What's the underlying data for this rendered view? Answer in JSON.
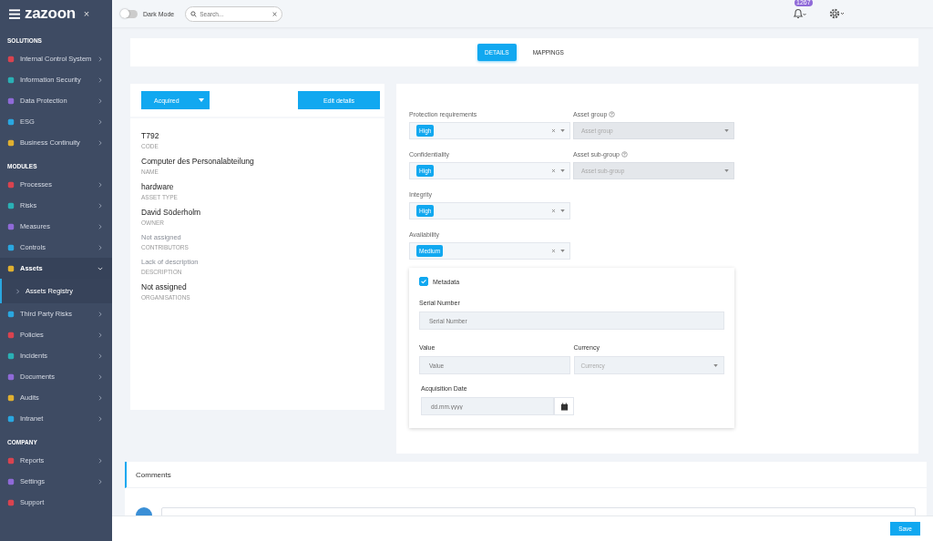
{
  "sidebar": {
    "logo": "zazoon",
    "close": "×",
    "sections": [
      {
        "heading": "SOLUTIONS",
        "items": [
          {
            "label": "Internal Control System",
            "color": "#d9434f",
            "expanded": false
          },
          {
            "label": "Information Security",
            "color": "#2ab0b5",
            "expanded": false
          },
          {
            "label": "Data Protection",
            "color": "#8f6ad8",
            "expanded": false
          },
          {
            "label": "ESG",
            "color": "#2aa7e0",
            "expanded": false
          },
          {
            "label": "Business Continuity",
            "color": "#e0b030",
            "expanded": false
          }
        ]
      },
      {
        "heading": "MODULES",
        "items": [
          {
            "label": "Processes",
            "color": "#d9434f",
            "expanded": false
          },
          {
            "label": "Risks",
            "color": "#2ab0b5",
            "expanded": false
          },
          {
            "label": "Measures",
            "color": "#8f6ad8",
            "expanded": false
          },
          {
            "label": "Controls",
            "color": "#2aa7e0",
            "expanded": false
          },
          {
            "label": "Assets",
            "color": "#e0b030",
            "expanded": true,
            "children": [
              {
                "label": "Assets Registry",
                "selected": true
              }
            ]
          },
          {
            "label": "Third Party Risks",
            "color": "#2aa7e0",
            "expanded": false
          },
          {
            "label": "Policies",
            "color": "#d9434f",
            "expanded": false
          },
          {
            "label": "Incidents",
            "color": "#2ab0b5",
            "expanded": false
          },
          {
            "label": "Documents",
            "color": "#8f6ad8",
            "expanded": false
          },
          {
            "label": "Audits",
            "color": "#e0b030",
            "expanded": false
          },
          {
            "label": "Intranet",
            "color": "#2aa7e0",
            "expanded": false
          }
        ]
      },
      {
        "heading": "COMPANY",
        "items": [
          {
            "label": "Reports",
            "color": "#d9434f",
            "expanded": false
          },
          {
            "label": "Settings",
            "color": "#8f6ad8",
            "expanded": false
          },
          {
            "label": "Support",
            "color": "#d9434f"
          }
        ]
      }
    ]
  },
  "topbar": {
    "dark_mode": {
      "label": "Dark Mode",
      "on": false
    },
    "search": {
      "placeholder": "Search..."
    },
    "notifications": {
      "badge": "1267"
    }
  },
  "tabs": [
    {
      "label": "DETAILS",
      "selected": true
    },
    {
      "label": "MAPPINGS",
      "selected": false
    }
  ],
  "summary": {
    "status": "Acquired",
    "edit_button": "Edit details",
    "fields": [
      {
        "value": "T792",
        "label": "CODE",
        "muted": false
      },
      {
        "value": "Computer des Personalabteilung",
        "label": "NAME",
        "muted": false
      },
      {
        "value": "hardware",
        "label": "ASSET TYPE",
        "muted": false
      },
      {
        "value": "David Söderholm",
        "label": "OWNER",
        "muted": false
      },
      {
        "value": "Not assigned",
        "label": "CONTRIBUTORS",
        "muted": true
      },
      {
        "value": "Lack of description",
        "label": "DESCRIPTION",
        "muted": true
      },
      {
        "value": "Not assigned",
        "label": "ORGANISATIONS",
        "muted": false
      }
    ]
  },
  "classification": [
    {
      "label": "Protection requirements",
      "help": false,
      "tag": "High",
      "disabled": false
    },
    {
      "label": "Asset group",
      "help": true,
      "placeholder": "Asset group",
      "disabled": true
    },
    {
      "label": "Confidentiality",
      "help": false,
      "tag": "High",
      "disabled": false
    },
    {
      "label": "Asset sub-group",
      "help": true,
      "placeholder": "Asset sub-group",
      "disabled": true
    },
    {
      "label": "Integrity",
      "help": false,
      "tag": "High",
      "disabled": false
    },
    {
      "label": "Availability",
      "help": false,
      "tag": "Medium",
      "disabled": false
    }
  ],
  "metadata": {
    "label": "Metadata",
    "checked": true,
    "serial_number": {
      "label": "Serial Number",
      "placeholder": "Serial Number"
    },
    "value": {
      "label": "Value",
      "placeholder": "Value"
    },
    "currency": {
      "label": "Currency",
      "placeholder": "Currency"
    },
    "acquisition_date": {
      "label": "Acquisition Date",
      "placeholder": "dd.mm.yyyy"
    }
  },
  "comments": {
    "title": "Comments"
  },
  "footer": {
    "save": "Save"
  }
}
